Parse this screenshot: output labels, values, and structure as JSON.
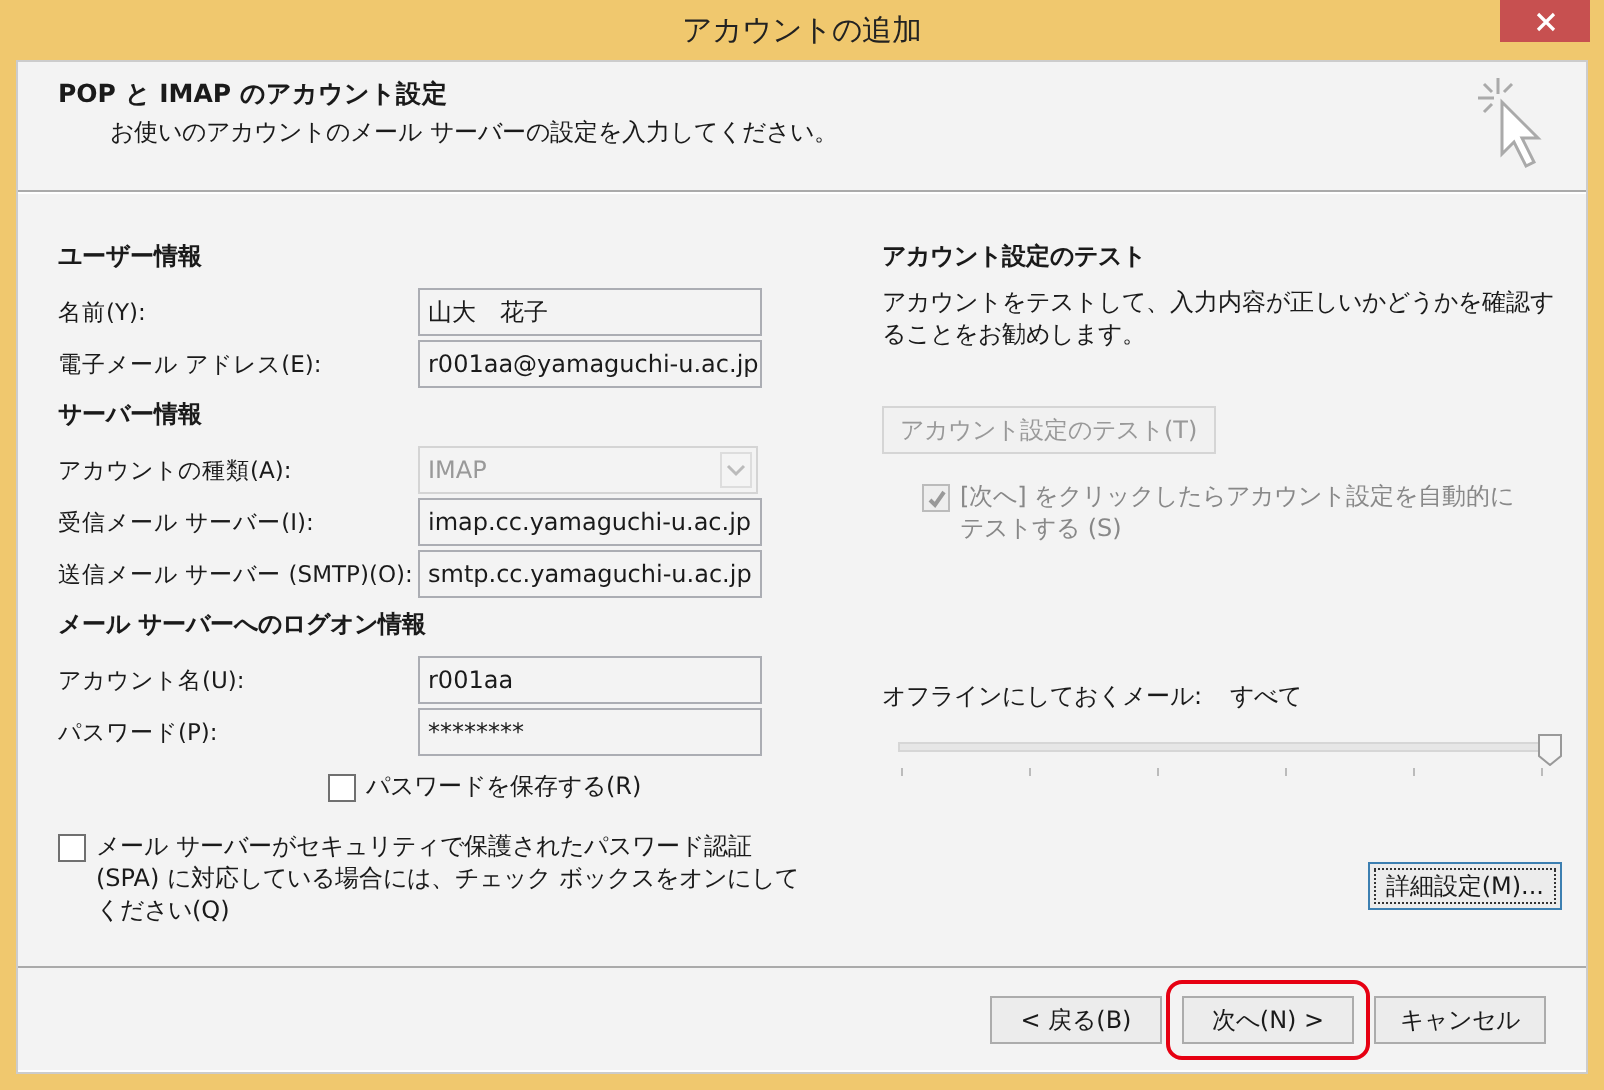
{
  "window": {
    "title": "アカウントの追加"
  },
  "header": {
    "title": "POP と IMAP のアカウント設定",
    "subtitle": "お使いのアカウントのメール サーバーの設定を入力してください。"
  },
  "sections": [
    {
      "heading": "ユーザー情報",
      "fields": [
        {
          "label": "名前(Y):",
          "value": "山大　花子",
          "kind": "text",
          "disabled": false
        },
        {
          "label": "電子メール アドレス(E):",
          "value": "r001aa@yamaguchi-u.ac.jp",
          "kind": "text",
          "disabled": false
        }
      ]
    },
    {
      "heading": "サーバー情報",
      "fields": [
        {
          "label": "アカウントの種類(A):",
          "value": "IMAP",
          "kind": "select",
          "disabled": true
        },
        {
          "label": "受信メール サーバー(I):",
          "value": "imap.cc.yamaguchi-u.ac.jp",
          "kind": "text",
          "disabled": false
        },
        {
          "label": "送信メール サーバー (SMTP)(O):",
          "value": "smtp.cc.yamaguchi-u.ac.jp",
          "kind": "text",
          "disabled": false
        }
      ]
    },
    {
      "heading": "メール サーバーへのログオン情報",
      "fields": [
        {
          "label": "アカウント名(U):",
          "value": "r001aa",
          "kind": "text",
          "disabled": false
        },
        {
          "label": "パスワード(P):",
          "value": "********",
          "kind": "text",
          "disabled": false
        }
      ]
    }
  ],
  "save_password": {
    "label": "パスワードを保存する(R)",
    "checked": false
  },
  "spa": {
    "label": "メール サーバーがセキュリティで保護されたパスワード認証 (SPA) に対応している場合には、チェック ボックスをオンにしてください(Q)",
    "checked": false
  },
  "test": {
    "heading": "アカウント設定のテスト",
    "description": "アカウントをテストして、入力内容が正しいかどうかを確認することをお勧めします。",
    "button": {
      "label": "アカウント設定のテスト(T)",
      "disabled": true
    },
    "auto_test": {
      "label": "[次へ] をクリックしたらアカウント設定を自動的にテストする (S)",
      "checked": true,
      "disabled": true
    }
  },
  "offline": {
    "label": "オフラインにしておくメール:",
    "value": "すべて",
    "level": 1
  },
  "advanced_button": "詳細設定(M)...",
  "buttons": [
    {
      "label": "< 戻る(B)",
      "highlighted": false
    },
    {
      "label": "次へ(N) >",
      "highlighted": true
    },
    {
      "label": "キャンセル",
      "highlighted": false
    }
  ]
}
